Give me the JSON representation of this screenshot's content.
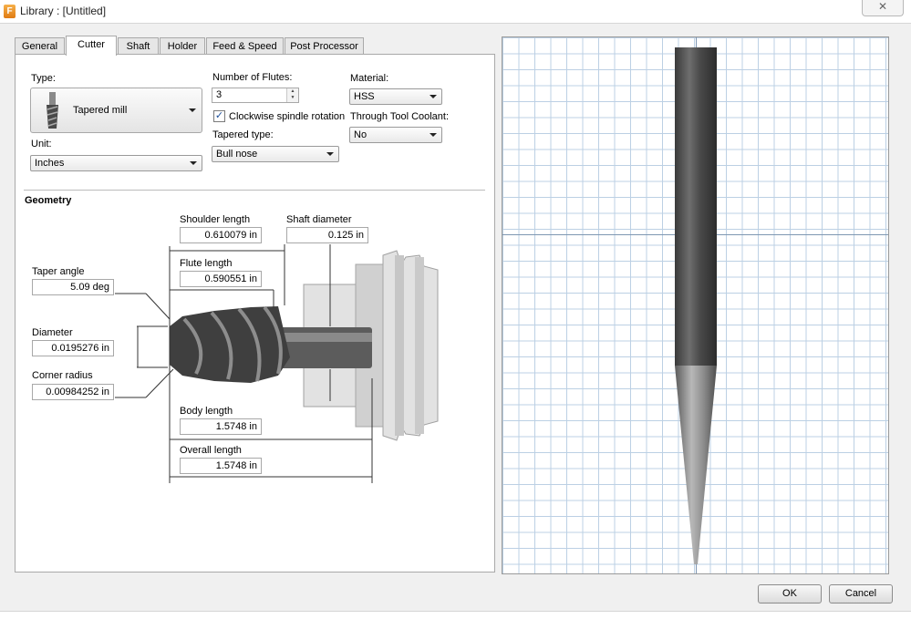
{
  "window": {
    "title": "Library : [Untitled]",
    "app_icon_letter": "F"
  },
  "tabs": [
    {
      "label": "General"
    },
    {
      "label": "Cutter"
    },
    {
      "label": "Shaft"
    },
    {
      "label": "Holder"
    },
    {
      "label": "Feed & Speed"
    },
    {
      "label": "Post Processor"
    }
  ],
  "cutter": {
    "type_label": "Type:",
    "type_value": "Tapered mill",
    "unit_label": "Unit:",
    "unit_value": "Inches",
    "flutes_label": "Number of Flutes:",
    "flutes_value": "3",
    "clockwise_label": "Clockwise spindle rotation",
    "clockwise_checked": true,
    "tapered_type_label": "Tapered type:",
    "tapered_type_value": "Bull nose",
    "material_label": "Material:",
    "material_value": "HSS",
    "coolant_label": "Through Tool Coolant:",
    "coolant_value": "No"
  },
  "geometry": {
    "heading": "Geometry",
    "shoulder_length_label": "Shoulder length",
    "shoulder_length_value": "0.610079 in",
    "shaft_diameter_label": "Shaft diameter",
    "shaft_diameter_value": "0.125 in",
    "flute_length_label": "Flute length",
    "flute_length_value": "0.590551 in",
    "taper_angle_label": "Taper angle",
    "taper_angle_value": "5.09 deg",
    "diameter_label": "Diameter",
    "diameter_value": "0.0195276 in",
    "corner_radius_label": "Corner radius",
    "corner_radius_value": "0.00984252 in",
    "body_length_label": "Body length",
    "body_length_value": "1.5748 in",
    "overall_length_label": "Overall length",
    "overall_length_value": "1.5748 in"
  },
  "buttons": {
    "ok": "OK",
    "cancel": "Cancel",
    "close": "✕"
  },
  "colors": {
    "grid_line": "#bcd0e4",
    "axis_line": "#7f97b2",
    "tool_dark": "#3a3a3a",
    "accent": "#1a4d99"
  }
}
